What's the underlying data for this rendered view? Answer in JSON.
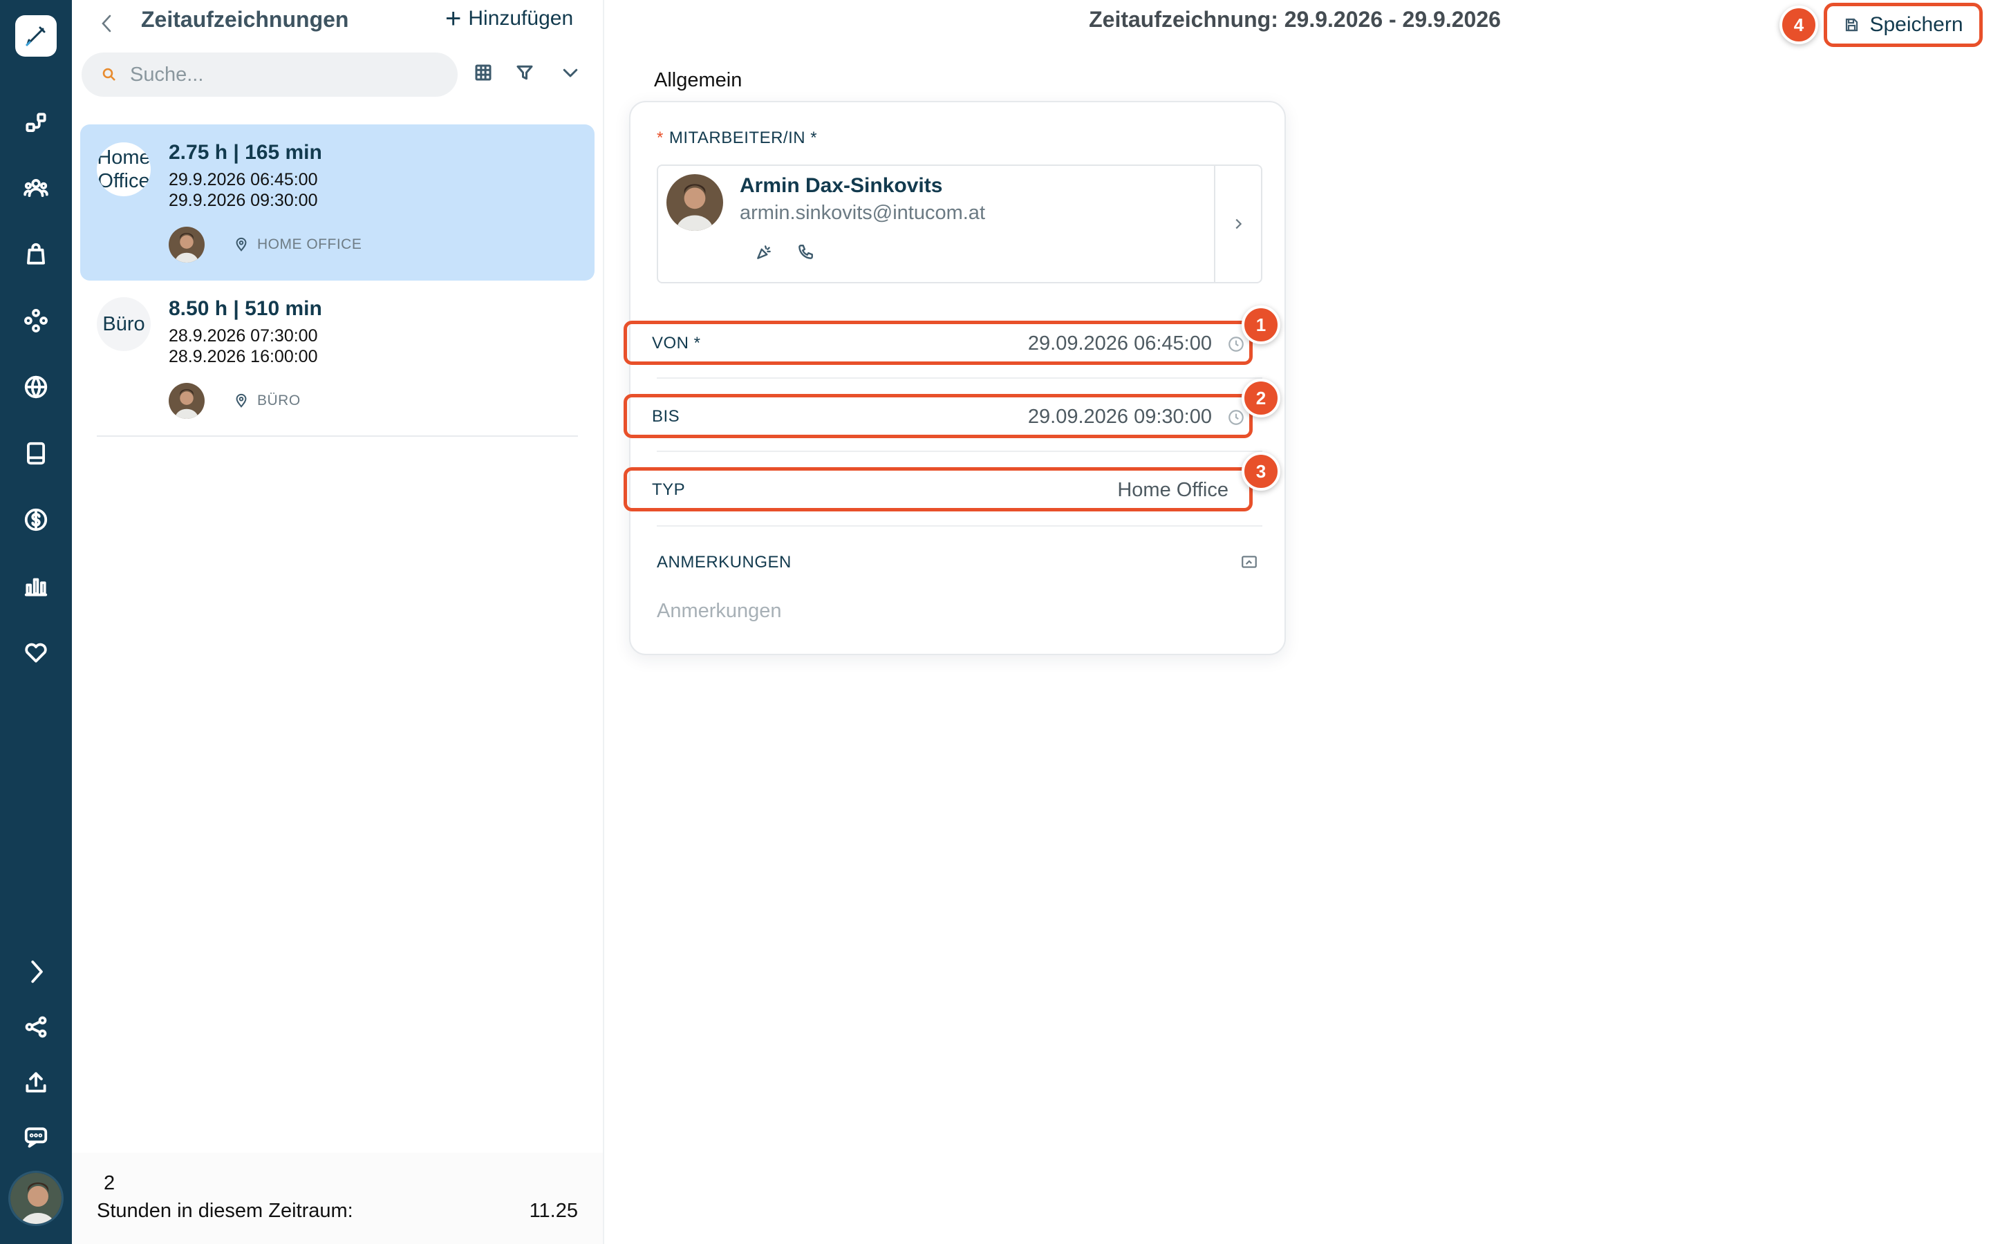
{
  "list": {
    "title": "Zeitaufzeichnungen",
    "add_label": "Hinzufügen",
    "search_placeholder": "Suche...",
    "entries": [
      {
        "badge": "Home Office",
        "duration": "2.75 h | 165 min",
        "from": "29.9.2026 06:45:00",
        "to": "29.9.2026 09:30:00",
        "location": "HOME OFFICE",
        "selected": true
      },
      {
        "badge": "Büro",
        "duration": "8.50 h | 510 min",
        "from": "28.9.2026 07:30:00",
        "to": "28.9.2026 16:00:00",
        "location": "BÜRO",
        "selected": false
      }
    ],
    "footer": {
      "count": "2",
      "hours_label": "Stunden in diesem Zeitraum:",
      "hours_value": "11.25"
    }
  },
  "detail": {
    "title": "Zeitaufzeichnung: 29.9.2026 - 29.9.2026",
    "save_label": "Speichern",
    "section_label": "Allgemein",
    "employee": {
      "label": "MITARBEITER/IN *",
      "required_mark": "*",
      "name": "Armin Dax-Sinkovits",
      "email": "armin.sinkovits@intucom.at"
    },
    "fields": {
      "von": {
        "label": "VON *",
        "value": "29.09.2026 06:45:00"
      },
      "bis": {
        "label": "BIS",
        "value": "29.09.2026 09:30:00"
      },
      "typ": {
        "label": "TYP",
        "value": "Home Office"
      }
    },
    "notes": {
      "label": "ANMERKUNGEN",
      "placeholder": "Anmerkungen"
    },
    "callouts": [
      "1",
      "2",
      "3",
      "4"
    ]
  },
  "colors": {
    "rail_bg": "#133c54",
    "accent_highlight": "#e8502a",
    "selected_entry_bg": "#c8e2fb",
    "text_primary": "#123a4e"
  },
  "icons": {
    "rail": [
      "pen-icon",
      "workflow-icon",
      "users-icon",
      "bag-icon",
      "modules-icon",
      "globe-icon",
      "book-icon",
      "dollar-icon",
      "chart-icon",
      "heart-icon",
      "chevron-right-icon",
      "share-icon",
      "upload-icon",
      "chat-icon"
    ]
  }
}
